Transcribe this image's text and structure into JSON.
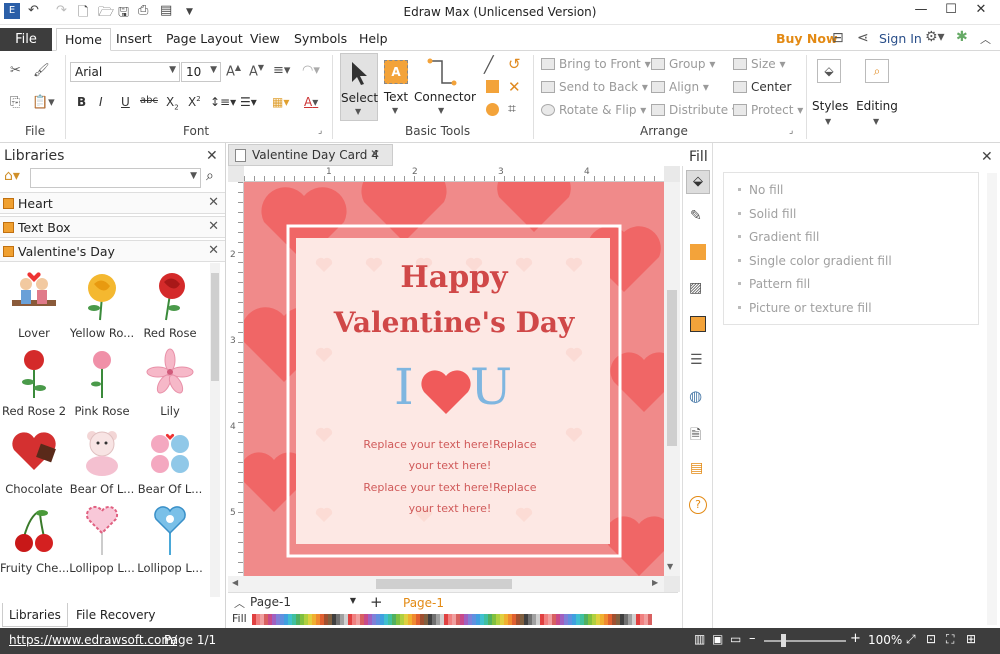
{
  "app": {
    "title": "Edraw Max (Unlicensed Version)"
  },
  "tabs": {
    "file": "File",
    "items": [
      "Home",
      "Insert",
      "Page Layout",
      "View",
      "Symbols",
      "Help"
    ],
    "active": "Home",
    "buy_now": "Buy Now",
    "sign_in": "Sign In"
  },
  "ribbon": {
    "groups": {
      "file": "File",
      "font": "Font",
      "basic_tools": "Basic Tools",
      "arrange": "Arrange"
    },
    "font_name": "Arial",
    "font_size": "10",
    "tools": {
      "select": "Select",
      "text": "Text",
      "connector": "Connector"
    },
    "arrange": {
      "bring_to_front": "Bring to Front",
      "send_to_back": "Send to Back",
      "rotate_flip": "Rotate & Flip",
      "group": "Group",
      "align": "Align",
      "distribute": "Distribute",
      "size": "Size",
      "center": "Center",
      "protect": "Protect"
    },
    "styles": "Styles",
    "editing": "Editing"
  },
  "libraries": {
    "title": "Libraries",
    "categories": [
      "Heart",
      "Text Box",
      "Valentine's Day"
    ],
    "items": [
      {
        "label": "Lover",
        "icon": "lover-icon"
      },
      {
        "label": "Yellow Ro...",
        "icon": "yellow-rose-icon"
      },
      {
        "label": "Red Rose",
        "icon": "red-rose-icon"
      },
      {
        "label": "Red Rose 2",
        "icon": "red-rose-2-icon"
      },
      {
        "label": "Pink Rose",
        "icon": "pink-rose-icon"
      },
      {
        "label": "Lily",
        "icon": "lily-icon"
      },
      {
        "label": "Chocolate",
        "icon": "chocolate-icon"
      },
      {
        "label": "Bear Of L...",
        "icon": "bear-icon"
      },
      {
        "label": "Bear Of L...",
        "icon": "bear-couple-icon"
      },
      {
        "label": "Fruity Che...",
        "icon": "cherry-icon"
      },
      {
        "label": "Lollipop L...",
        "icon": "lollipop-icon"
      },
      {
        "label": "Lollipop L...",
        "icon": "lollipop-2-icon"
      }
    ],
    "bottom_tabs": [
      "Libraries",
      "File Recovery"
    ]
  },
  "document": {
    "tab": "Valentine Day Card 4",
    "ruler_h": [
      "1",
      "2",
      "3",
      "4"
    ],
    "ruler_v": [
      "2",
      "3",
      "4",
      "5"
    ],
    "card": {
      "line1": "Happy",
      "line2": "Valentine's Day",
      "i_letter": "I",
      "u_letter": "U",
      "body1": "Replace your text here!Replace",
      "body2": "your text here!",
      "body3": "Replace your text here!Replace",
      "body4": "your text here!"
    },
    "page_tab": "Page-1",
    "page_tab_active": "Page-1",
    "fill_label": "Fill"
  },
  "fill_pane": {
    "title": "Fill",
    "options": [
      "No fill",
      "Solid fill",
      "Gradient fill",
      "Single color gradient fill",
      "Pattern fill",
      "Picture or texture fill"
    ]
  },
  "status": {
    "url": "https://www.edrawsoft.com/",
    "page": "Page 1/1",
    "zoom": "100%"
  },
  "colors": {
    "accent": "#e38a14",
    "card_bg": "#f08a8a",
    "heart": "#f05a5a",
    "title_text": "#d04848",
    "iu_blue": "#7fb6e0",
    "status_bg": "#3d3d3d"
  }
}
